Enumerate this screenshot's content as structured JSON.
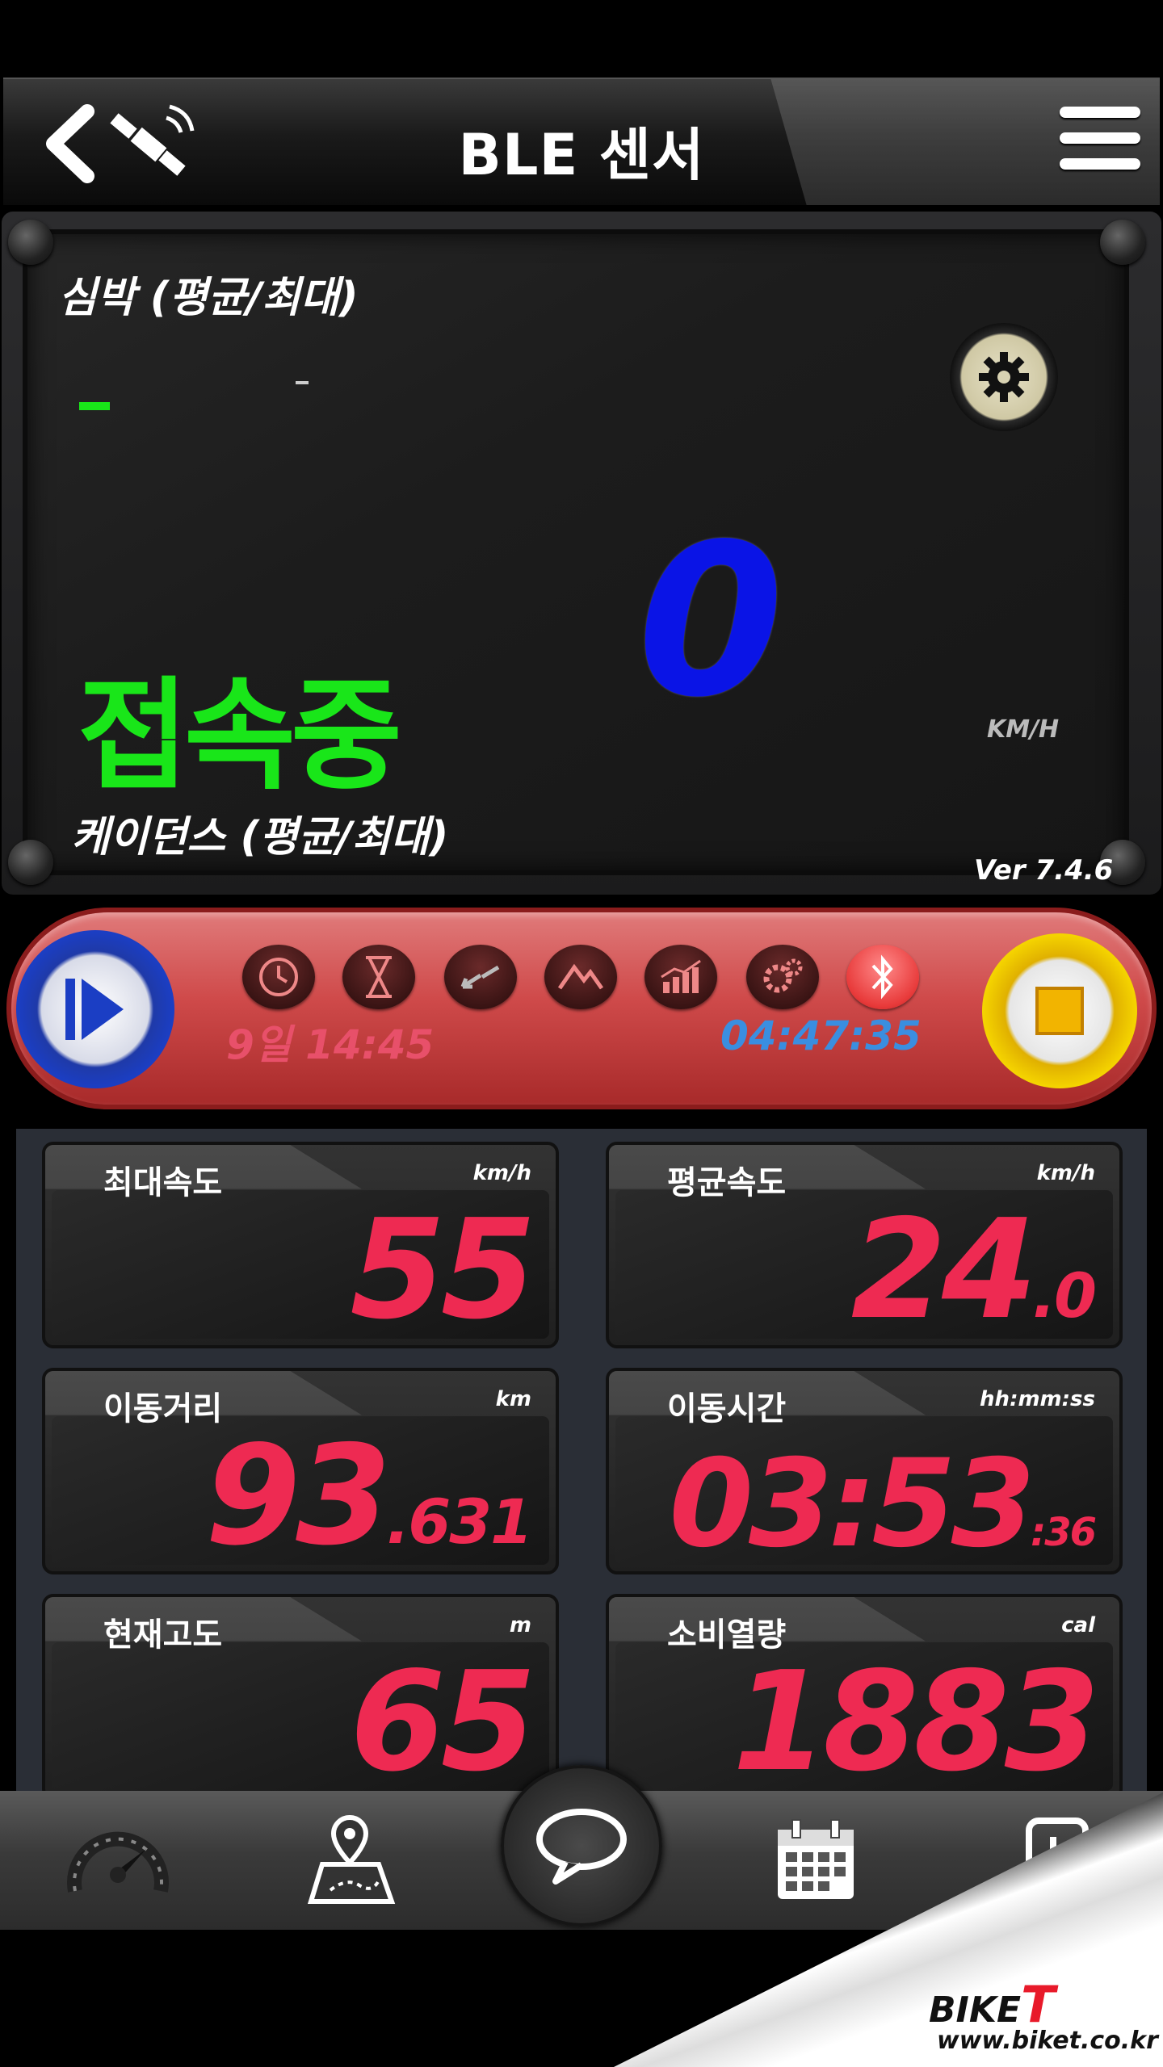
{
  "header": {
    "title": "BLE 센서",
    "back_icon": "chevron-left-icon",
    "gps_icon": "satellite-icon",
    "menu_icon": "hamburger-icon"
  },
  "display": {
    "heart_rate_label": "심박 (평균/최대)",
    "heart_rate_avg": "-",
    "heart_rate_max": "-",
    "status": "접속중",
    "speed": "0",
    "speed_unit": "KM/H",
    "cadence_label": "케이던스 (평균/최대)",
    "cadence_value": "-",
    "version": "Ver 7.4.6",
    "status_color": "#19e619",
    "speed_color": "#0a14e6"
  },
  "controls": {
    "clock": "9일 14:45",
    "elapsed": "04:47:35",
    "icons": [
      "clock-icon",
      "hourglass-icon",
      "swap-arrows-icon",
      "mountain-icon",
      "chart-icon",
      "settings-icon",
      "bluetooth-icon"
    ]
  },
  "stats": [
    {
      "label": "최대속도",
      "unit": "km/h",
      "value": "55",
      "decimal": ""
    },
    {
      "label": "평균속도",
      "unit": "km/h",
      "value": "24",
      "decimal": ".0"
    },
    {
      "label": "이동거리",
      "unit": "km",
      "value": "93",
      "decimal": ".631"
    },
    {
      "label": "이동시간",
      "unit": "hh:mm:ss",
      "value": "03:53",
      "decimal": ":36"
    },
    {
      "label": "현재고도",
      "unit": "m",
      "value": "65",
      "decimal": ""
    },
    {
      "label": "소비열량",
      "unit": "cal",
      "value": "1883",
      "decimal": ""
    }
  ],
  "nav": [
    "speedometer-icon",
    "map-icon",
    "chat-icon",
    "calendar-icon",
    "page-curl-icon"
  ],
  "brand": {
    "name_prefix": "BIKE",
    "name_suffix": "T",
    "url": "www.biket.co.kr"
  },
  "accent_colors": {
    "value_red": "#ee2a52",
    "timer_blue": "#3a8ee0",
    "control_red": "#cf4a4a"
  }
}
